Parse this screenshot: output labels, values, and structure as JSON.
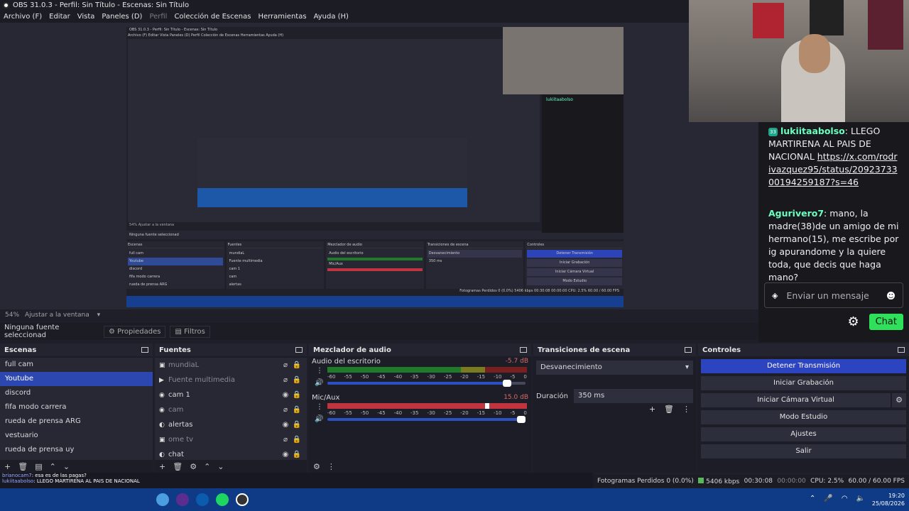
{
  "window": {
    "title": "OBS 31.0.3 - Perfil: Sin Título - Escenas: Sin Título"
  },
  "menu": [
    {
      "label": "Archivo (F)",
      "disabled": false
    },
    {
      "label": "Editar",
      "disabled": false
    },
    {
      "label": "Vista",
      "disabled": false
    },
    {
      "label": "Paneles (D)",
      "disabled": false
    },
    {
      "label": "Perfil",
      "disabled": true
    },
    {
      "label": "Colección de Escenas",
      "disabled": false
    },
    {
      "label": "Herramientas",
      "disabled": false
    },
    {
      "label": "Ayuda (H)",
      "disabled": false
    }
  ],
  "zoom": {
    "percent": "54%",
    "fit_label": "Ajustar a la ventana"
  },
  "source_bar": {
    "no_source": "Ninguna fuente seleccionad",
    "properties": "Propiedades",
    "filters": "Filtros"
  },
  "panels": {
    "scenes": "Escenas",
    "sources": "Fuentes",
    "mixer": "Mezclador de audio",
    "transitions": "Transiciones de escena",
    "controls": "Controles"
  },
  "scenes": [
    {
      "label": "full cam",
      "selected": false
    },
    {
      "label": "Youtube",
      "selected": true
    },
    {
      "label": "discord",
      "selected": false
    },
    {
      "label": "fifa modo carrera",
      "selected": false
    },
    {
      "label": "rueda de prensa ARG",
      "selected": false
    },
    {
      "label": "vestuario",
      "selected": false
    },
    {
      "label": "rueda de prensa uy",
      "selected": false
    }
  ],
  "sources": [
    {
      "label": "mundiaL",
      "icon": "image-icon",
      "visible": false
    },
    {
      "label": "Fuente multimedia",
      "icon": "play-icon",
      "visible": false
    },
    {
      "label": "cam 1",
      "icon": "camera-icon",
      "visible": true
    },
    {
      "label": "cam",
      "icon": "camera-icon",
      "visible": false
    },
    {
      "label": "alertas",
      "icon": "globe-icon",
      "visible": true
    },
    {
      "label": "ome tv",
      "icon": "image-icon",
      "visible": false
    },
    {
      "label": "chat",
      "icon": "globe-icon",
      "visible": true
    }
  ],
  "mixer": [
    {
      "name": "Audio del escritorio",
      "db": "-5.7 dB",
      "level_pct": 67,
      "volume_pct": 93,
      "meter": "green"
    },
    {
      "name": "Mic/Aux",
      "db": "15.0 dB",
      "level_pct": 81,
      "volume_pct": 100,
      "meter": "red"
    }
  ],
  "scale_ticks": [
    "-60",
    "-55",
    "-50",
    "-45",
    "-40",
    "-35",
    "-30",
    "-25",
    "-20",
    "-15",
    "-10",
    "-5",
    "0"
  ],
  "transitions": {
    "selected": "Desvanecimiento",
    "duration_label": "Duración",
    "duration_value": "350 ms"
  },
  "controls": [
    "Detener Transmisión",
    "Iniciar Grabación",
    "Iniciar Cámara Virtual",
    "Modo Estudio",
    "Ajustes",
    "Salir"
  ],
  "status": {
    "dropped": "Fotogramas Perdidos 0 (0.0%)",
    "kbps": "5406 kbps",
    "stream_time": "00:30:08",
    "rec_time": "00:00:00",
    "cpu": "CPU: 2.5%",
    "fps": "60.00 / 60.00 FPS"
  },
  "chat_overlay": [
    {
      "user": "brianocam7",
      "text": ": esa es de las pagas?"
    },
    {
      "user": "lukiitaabolso",
      "text": ": LLEGO MARTIRENA AL PAIS DE NACIONAL"
    }
  ],
  "taskbar": {
    "time": "19:20",
    "date": "25/08/2026"
  },
  "chat": {
    "messages": [
      {
        "badge": "33",
        "user": "lukiitaabolso",
        "text": "LLEGO MARTIRENA AL PAIS DE NACIONAL",
        "link": "https://x.com/rodrivazquez95/status/2092373300194259187?s=46"
      },
      {
        "badge": "",
        "user": "Agurivero7",
        "text": "mano, la madre(38)de un amigo de mi hermano(15), me escribe por ig apurandome y la quiere toda, que decis que haga mano?",
        "link": ""
      }
    ],
    "input_placeholder": "Enviar un mensaje",
    "chat_button": "Chat"
  },
  "nested": {
    "title": "OBS 31.0.3 - Perfil: Sin Título - Escenas: Sin Título",
    "menu": "Archivo (F)  Editar  Vista  Paneles (D)  Perfil  Colección de Escenas  Herramientas  Ayuda (H)",
    "zoom": "54%   Ajustar a la ventana",
    "no_source": "Ninguna fuente seleccionad",
    "status": "Fotogramas Perdidos 0 (0.0%)   5406 kbps   00:30:08   00:00:00   CPU: 2.5%   60.00 / 60.00 FPS"
  },
  "colors": {
    "accent": "#2c48b0",
    "chat_user": "#6bffbf",
    "chat_button": "#2fe05b",
    "meter_red": "#c0343f"
  }
}
